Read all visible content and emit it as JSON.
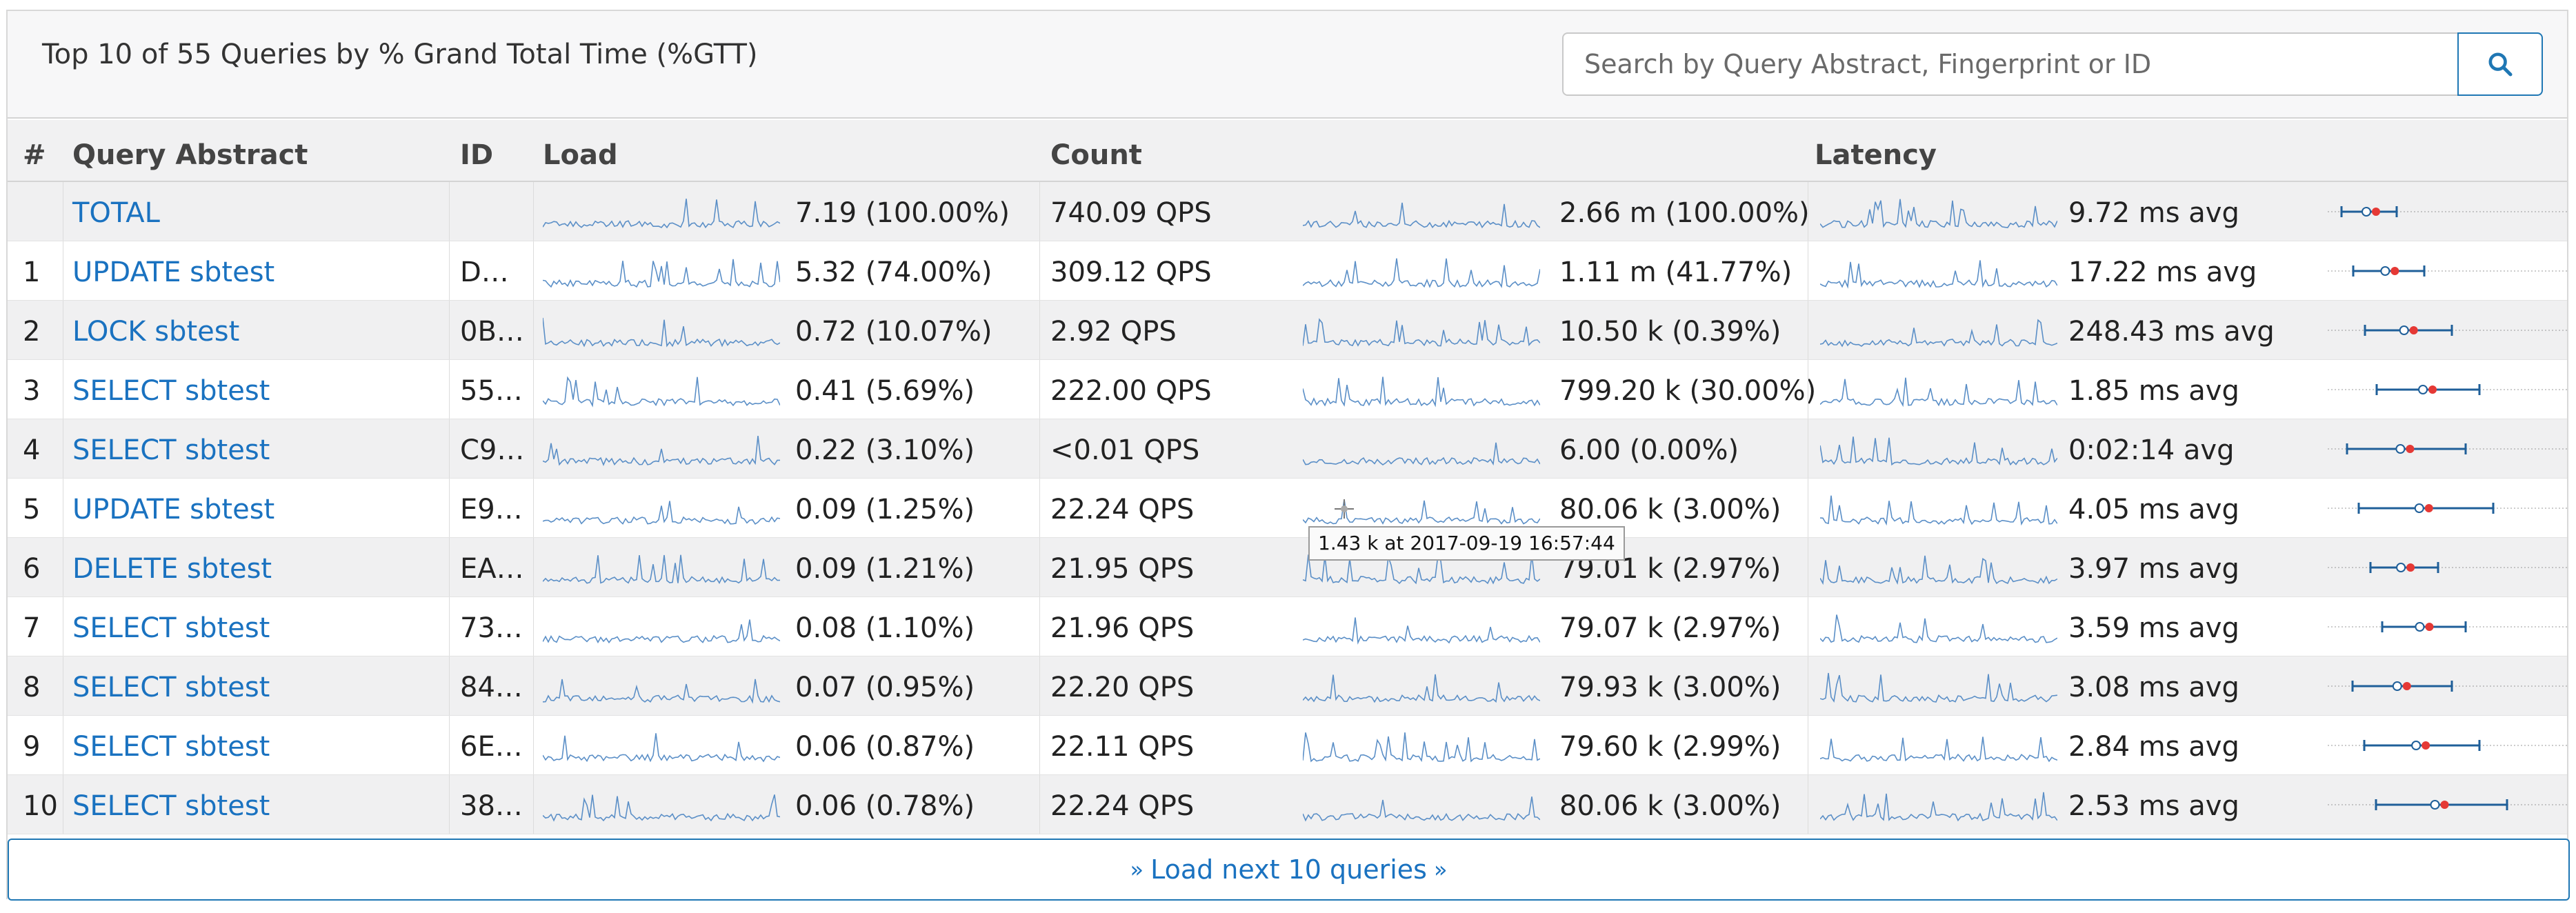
{
  "header": {
    "title": "Top 10 of 55 Queries by % Grand Total Time (%GTT)",
    "search_placeholder": "Search by Query Abstract, Fingerprint or ID"
  },
  "columns": {
    "num": "#",
    "abstract": "Query Abstract",
    "id": "ID",
    "load": "Load",
    "count": "Count",
    "latency": "Latency"
  },
  "rows": [
    {
      "num": "",
      "abstract": "TOTAL",
      "id": "",
      "load": "7.19 (100.00%)",
      "qps": "740.09 QPS",
      "count": "2.66 m (100.00%)",
      "latency": "9.72 ms avg"
    },
    {
      "num": "1",
      "abstract": "UPDATE sbtest",
      "id": "D…",
      "load": "5.32 (74.00%)",
      "qps": "309.12 QPS",
      "count": "1.11 m (41.77%)",
      "latency": "17.22 ms avg"
    },
    {
      "num": "2",
      "abstract": "LOCK sbtest",
      "id": "0B…",
      "load": "0.72 (10.07%)",
      "qps": "2.92 QPS",
      "count": "10.50 k (0.39%)",
      "latency": "248.43 ms avg"
    },
    {
      "num": "3",
      "abstract": "SELECT sbtest",
      "id": "55…",
      "load": "0.41 (5.69%)",
      "qps": "222.00 QPS",
      "count": "799.20 k (30.00%)",
      "latency": "1.85 ms avg"
    },
    {
      "num": "4",
      "abstract": "SELECT sbtest",
      "id": "C9…",
      "load": "0.22 (3.10%)",
      "qps": "<0.01 QPS",
      "count": "6.00 (0.00%)",
      "latency": "0:02:14 avg"
    },
    {
      "num": "5",
      "abstract": "UPDATE sbtest",
      "id": "E9…",
      "load": "0.09 (1.25%)",
      "qps": "22.24 QPS",
      "count": "80.06 k (3.00%)",
      "latency": "4.05 ms avg"
    },
    {
      "num": "6",
      "abstract": "DELETE sbtest",
      "id": "EA…",
      "load": "0.09 (1.21%)",
      "qps": "21.95 QPS",
      "count": "79.01 k (2.97%)",
      "latency": "3.97 ms avg"
    },
    {
      "num": "7",
      "abstract": "SELECT sbtest",
      "id": "73…",
      "load": "0.08 (1.10%)",
      "qps": "21.96 QPS",
      "count": "79.07 k (2.97%)",
      "latency": "3.59 ms avg"
    },
    {
      "num": "8",
      "abstract": "SELECT sbtest",
      "id": "84…",
      "load": "0.07 (0.95%)",
      "qps": "22.20 QPS",
      "count": "79.93 k (3.00%)",
      "latency": "3.08 ms avg"
    },
    {
      "num": "9",
      "abstract": "SELECT sbtest",
      "id": "6E…",
      "load": "0.06 (0.87%)",
      "qps": "22.11 QPS",
      "count": "79.60 k (2.99%)",
      "latency": "2.84 ms avg"
    },
    {
      "num": "10",
      "abstract": "SELECT sbtest",
      "id": "38…",
      "load": "0.06 (0.78%)",
      "qps": "22.24 QPS",
      "count": "80.06 k (3.00%)",
      "latency": "2.53 ms avg"
    }
  ],
  "tooltip": "1.43 k at 2017-09-19 16:57:44",
  "load_more": "Load next 10 queries",
  "colors": {
    "link": "#1a72c0",
    "sparkline": "#5b8fc7",
    "latency_bar": "#1f5f99",
    "latency_avg_dot": "#e53935"
  }
}
